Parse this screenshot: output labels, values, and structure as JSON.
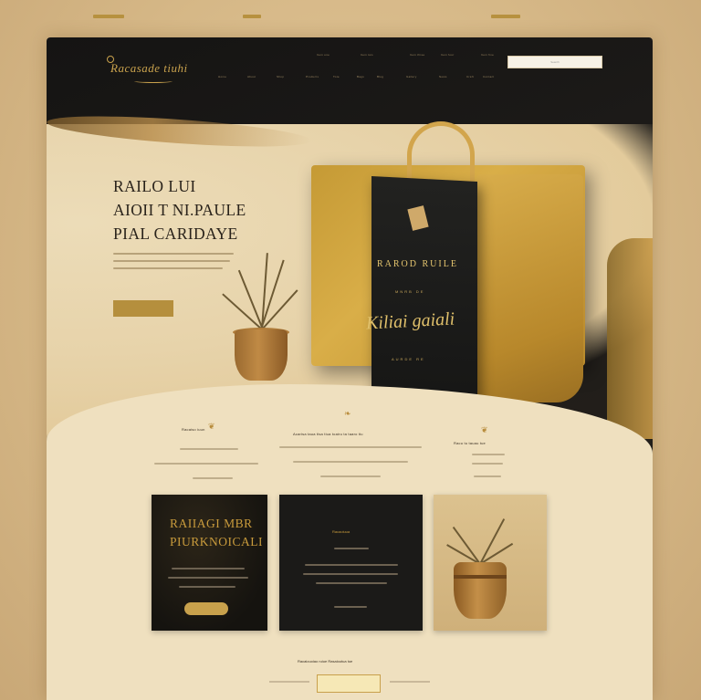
{
  "header": {
    "logo_text": "Racasade tiuhi",
    "nav_top": [
      "Item one",
      "Item two",
      "Item three",
      "Item four",
      "Item five"
    ],
    "nav_bottom": [
      "Home",
      "About",
      "Shop",
      "Products",
      "Tote",
      "Bags",
      "Blog",
      "Gallery",
      "News",
      "Craft",
      "Contact"
    ],
    "search_placeholder": "Search"
  },
  "hero": {
    "title_line1": "RAILO LUI",
    "title_line2": "AIOII T NI.PAULE",
    "title_line3": "PIAL CARIDAYE",
    "subtitle": "",
    "button_label": ""
  },
  "bag": {
    "text1": "RAROD RUILE",
    "text2": "MNRB DE",
    "script": "Kiliai gaiali",
    "text3": "AURDE RE"
  },
  "features": [
    {
      "title": "Racaiso iuun"
    },
    {
      "title": "Acarisa taua tisa tiua toairu ta taaro tiu"
    },
    {
      "title": "Racu tu tauau tue"
    }
  ],
  "cards": {
    "card1_title_line1": "RAIIAGI MBR",
    "card1_title_line2": "PIURKNOICALI",
    "card2_title": "Racaoiuua"
  },
  "footer": {
    "text": "Racaiouoiao ruiue Rasaioutua tue",
    "button_label": ""
  },
  "colors": {
    "gold": "#c9a24d",
    "dark": "#151413",
    "cream": "#efe0bf"
  }
}
